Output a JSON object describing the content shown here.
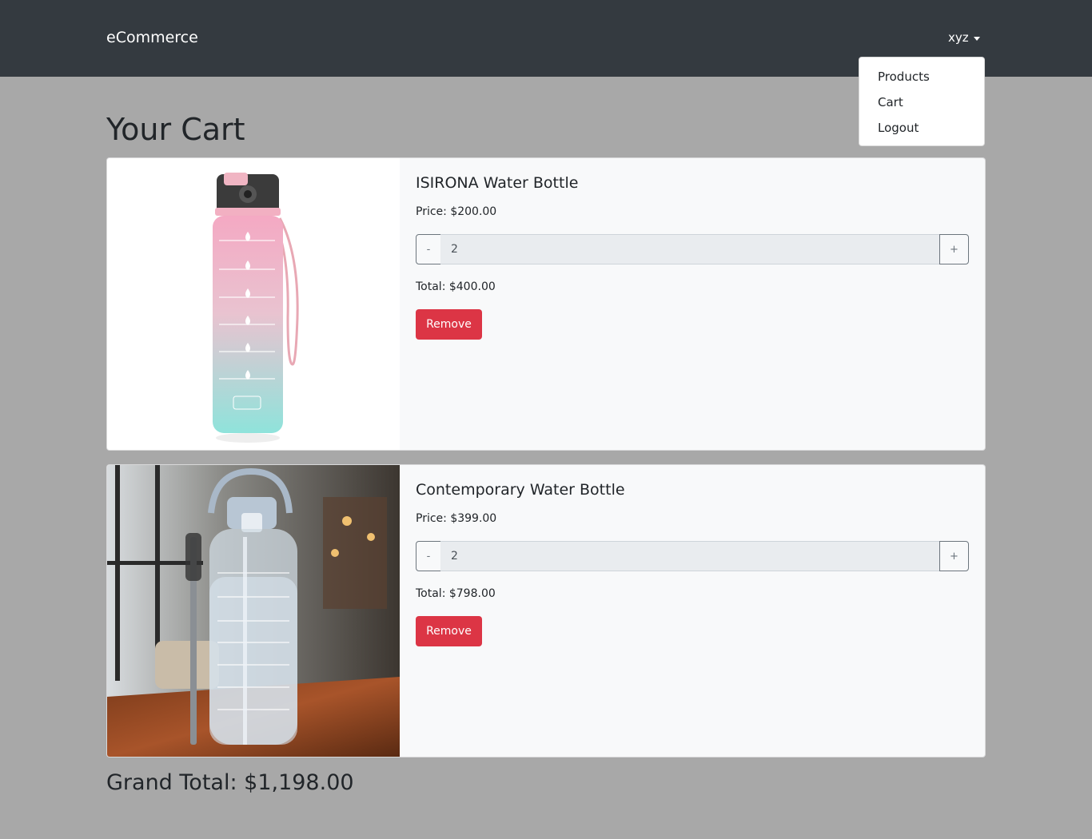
{
  "navbar": {
    "brand": "eCommerce",
    "user_label": "xyz",
    "menu": {
      "products": "Products",
      "cart": "Cart",
      "logout": "Logout"
    }
  },
  "page": {
    "title": "Your Cart"
  },
  "cart": {
    "items": [
      {
        "name": "ISIRONA Water Bottle",
        "price": "Price: $200.00",
        "quantity": "2",
        "decrement_label": "-",
        "increment_label": "+",
        "total": "Total: $400.00",
        "remove_label": "Remove"
      },
      {
        "name": "Contemporary Water Bottle",
        "price": "Price: $399.00",
        "quantity": "2",
        "decrement_label": "-",
        "increment_label": "+",
        "total": "Total: $798.00",
        "remove_label": "Remove"
      }
    ],
    "grand_total": "Grand Total: $1,198.00"
  },
  "colors": {
    "navbar": "#343a40",
    "page_background": "#a8a8a8",
    "card_background": "#f8f9fa",
    "danger": "#dc3545"
  }
}
